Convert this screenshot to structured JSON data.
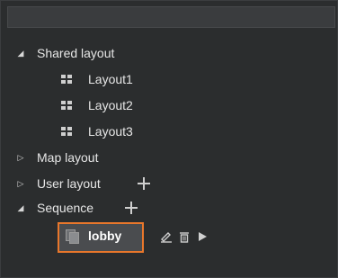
{
  "search": {
    "value": ""
  },
  "tree": {
    "shared": {
      "label": "Shared layout",
      "items": [
        {
          "label": "Layout1"
        },
        {
          "label": "Layout2"
        },
        {
          "label": "Layout3"
        }
      ]
    },
    "map": {
      "label": "Map layout"
    },
    "user": {
      "label": "User layout"
    },
    "sequence": {
      "label": "Sequence",
      "items": [
        {
          "label": "lobby"
        }
      ]
    }
  },
  "colors": {
    "background": "#2b2d2e",
    "selection_border": "#e9772b",
    "selection_fill": "#4a4c4f"
  },
  "icons": {
    "expanded": "triangle-down-right-icon",
    "collapsed": "triangle-right-outline-icon",
    "layout": "grid-icon",
    "add": "plus-icon",
    "sequence": "stacked-pages-icon",
    "edit": "pencil-icon",
    "delete": "trash-icon",
    "play": "play-icon"
  }
}
